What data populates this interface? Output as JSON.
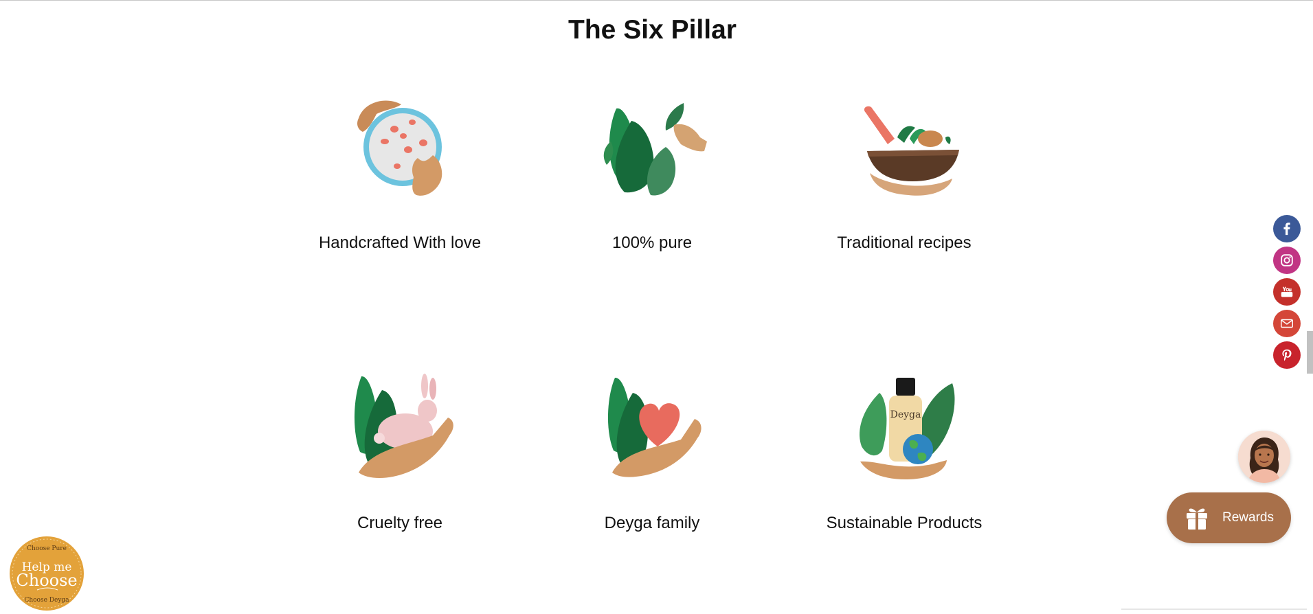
{
  "section": {
    "title": "The Six Pillar"
  },
  "pillars": [
    {
      "label": "Handcrafted With love",
      "icon": "hands-holding-petal-bowl-icon"
    },
    {
      "label": "100% pure",
      "icon": "hand-picking-leaves-icon"
    },
    {
      "label": "Traditional recipes",
      "icon": "mortar-and-pestle-icon"
    },
    {
      "label": "Cruelty free",
      "icon": "hand-holding-rabbit-icon"
    },
    {
      "label": "Deyga family",
      "icon": "hand-holding-heart-icon"
    },
    {
      "label": "Sustainable Products",
      "icon": "bottle-with-globe-icon"
    }
  ],
  "product_label": "Deyga",
  "social": [
    {
      "name": "facebook",
      "icon": "facebook-icon",
      "color": "#3b5998"
    },
    {
      "name": "instagram",
      "icon": "instagram-icon",
      "color": "#c13584"
    },
    {
      "name": "youtube",
      "icon": "youtube-icon",
      "color": "#c4302b"
    },
    {
      "name": "email",
      "icon": "email-icon",
      "color": "#d44638"
    },
    {
      "name": "pinterest",
      "icon": "pinterest-icon",
      "color": "#c8232c"
    }
  ],
  "rewards": {
    "label": "Rewards",
    "icon": "gift-icon",
    "color": "#a8704a"
  },
  "help_badge": {
    "top": "Choose Pure",
    "line1": "Help me",
    "line2": "Choose",
    "bottom": "Choose Deyga",
    "color": "#e3a23a"
  },
  "assistant": {
    "icon": "assistant-avatar-icon"
  }
}
